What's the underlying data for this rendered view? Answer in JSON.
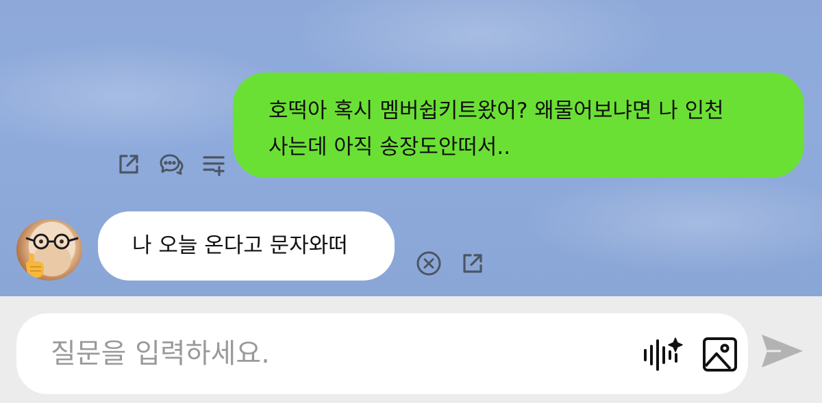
{
  "messages": {
    "sent": {
      "line1": "호떡아 혹시 멤버쉽키트왔어? 왜물어보냐면 나 인천",
      "line2": "사는데 아직 송장도안떠서..",
      "actions": [
        "share-icon",
        "chat-bubbles-icon",
        "add-to-list-icon"
      ],
      "bubble_color": "#6be034"
    },
    "received": {
      "text": "나 오늘 온다고 문자와떠",
      "actions": [
        "close-circle-icon",
        "share-icon"
      ],
      "bubble_color": "#ffffff"
    }
  },
  "input": {
    "placeholder": "질문을 입력하세요.",
    "voice_icon": "voice-sparkle-icon",
    "image_icon": "image-icon",
    "send_icon": "send-arrow-icon"
  },
  "colors": {
    "chat_background": "#8ea9d9",
    "icon_gray": "#4b5563",
    "send_disabled": "#b3b3b3"
  }
}
